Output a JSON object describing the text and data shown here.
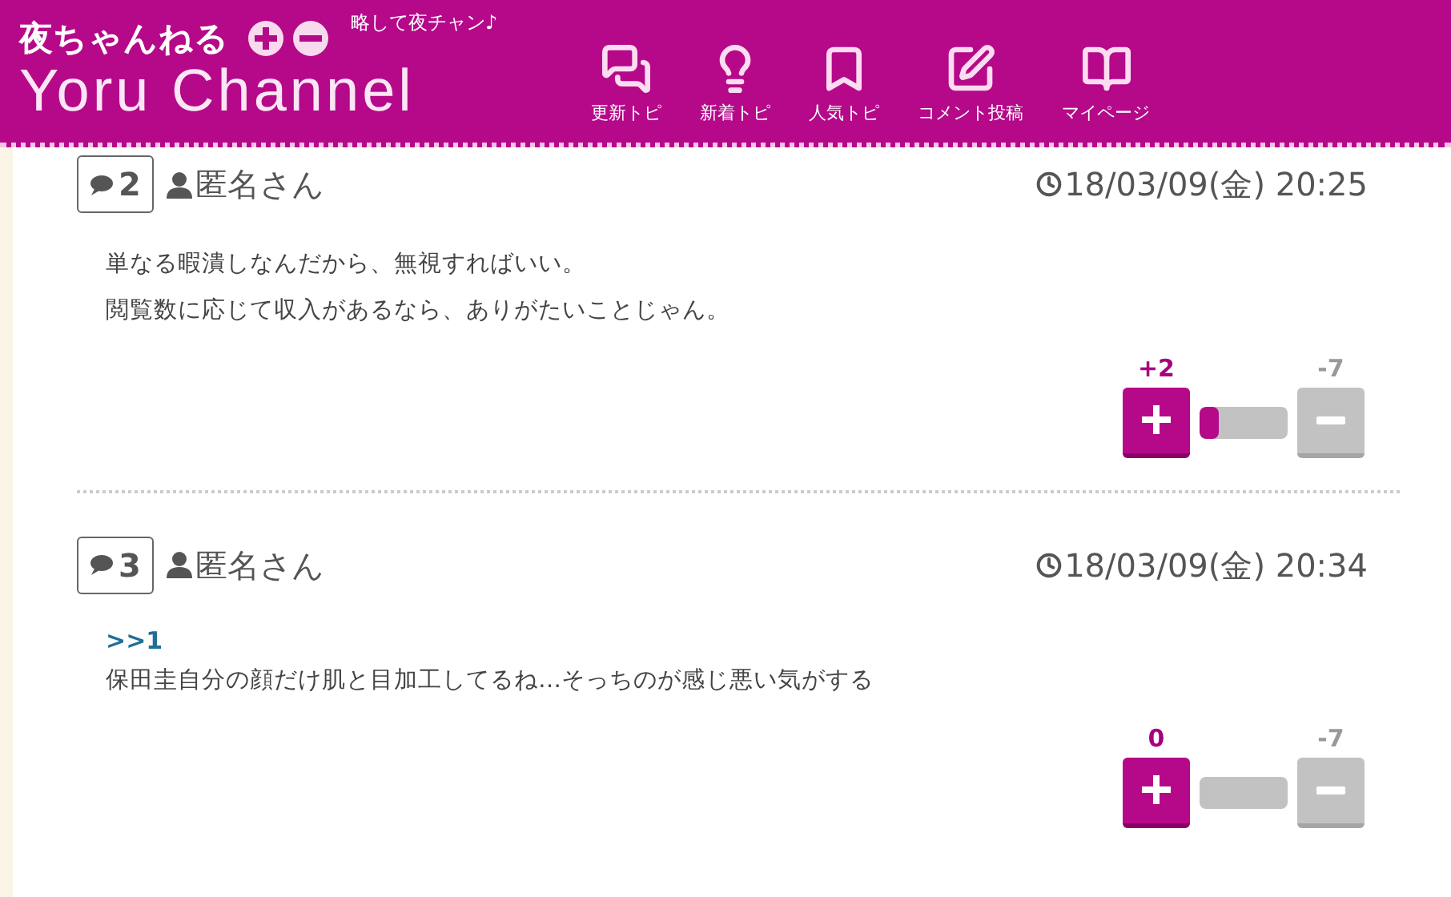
{
  "header": {
    "title_jp": "夜ちゃんねる",
    "title_en": "Yoru Channel",
    "tagline": "略して夜チャン♪",
    "nav": [
      {
        "kind": "chat",
        "label": "更新トピ"
      },
      {
        "kind": "bulb",
        "label": "新着トピ"
      },
      {
        "kind": "bookmark",
        "label": "人気トピ"
      },
      {
        "kind": "edit",
        "label": "コメント投稿"
      },
      {
        "kind": "book",
        "label": "マイページ"
      }
    ]
  },
  "comments": [
    {
      "number": "2",
      "author": "匿名さん",
      "datetime": "18/03/09(金) 20:25",
      "lines": [
        "単なる暇潰しなんだから、無視すればいい。",
        "閲覧数に応じて収入があるなら、ありがたいことじゃん。"
      ],
      "plus": "+2",
      "minus": "-7",
      "level": 0.22
    },
    {
      "number": "3",
      "author": "匿名さん",
      "datetime": "18/03/09(金) 20:34",
      "anchor": ">>1",
      "lines": [
        "保田圭自分の顔だけ肌と目加工してるね…そっちのが感じ悪い気がする"
      ],
      "plus": "0",
      "minus": "-7"
    }
  ]
}
